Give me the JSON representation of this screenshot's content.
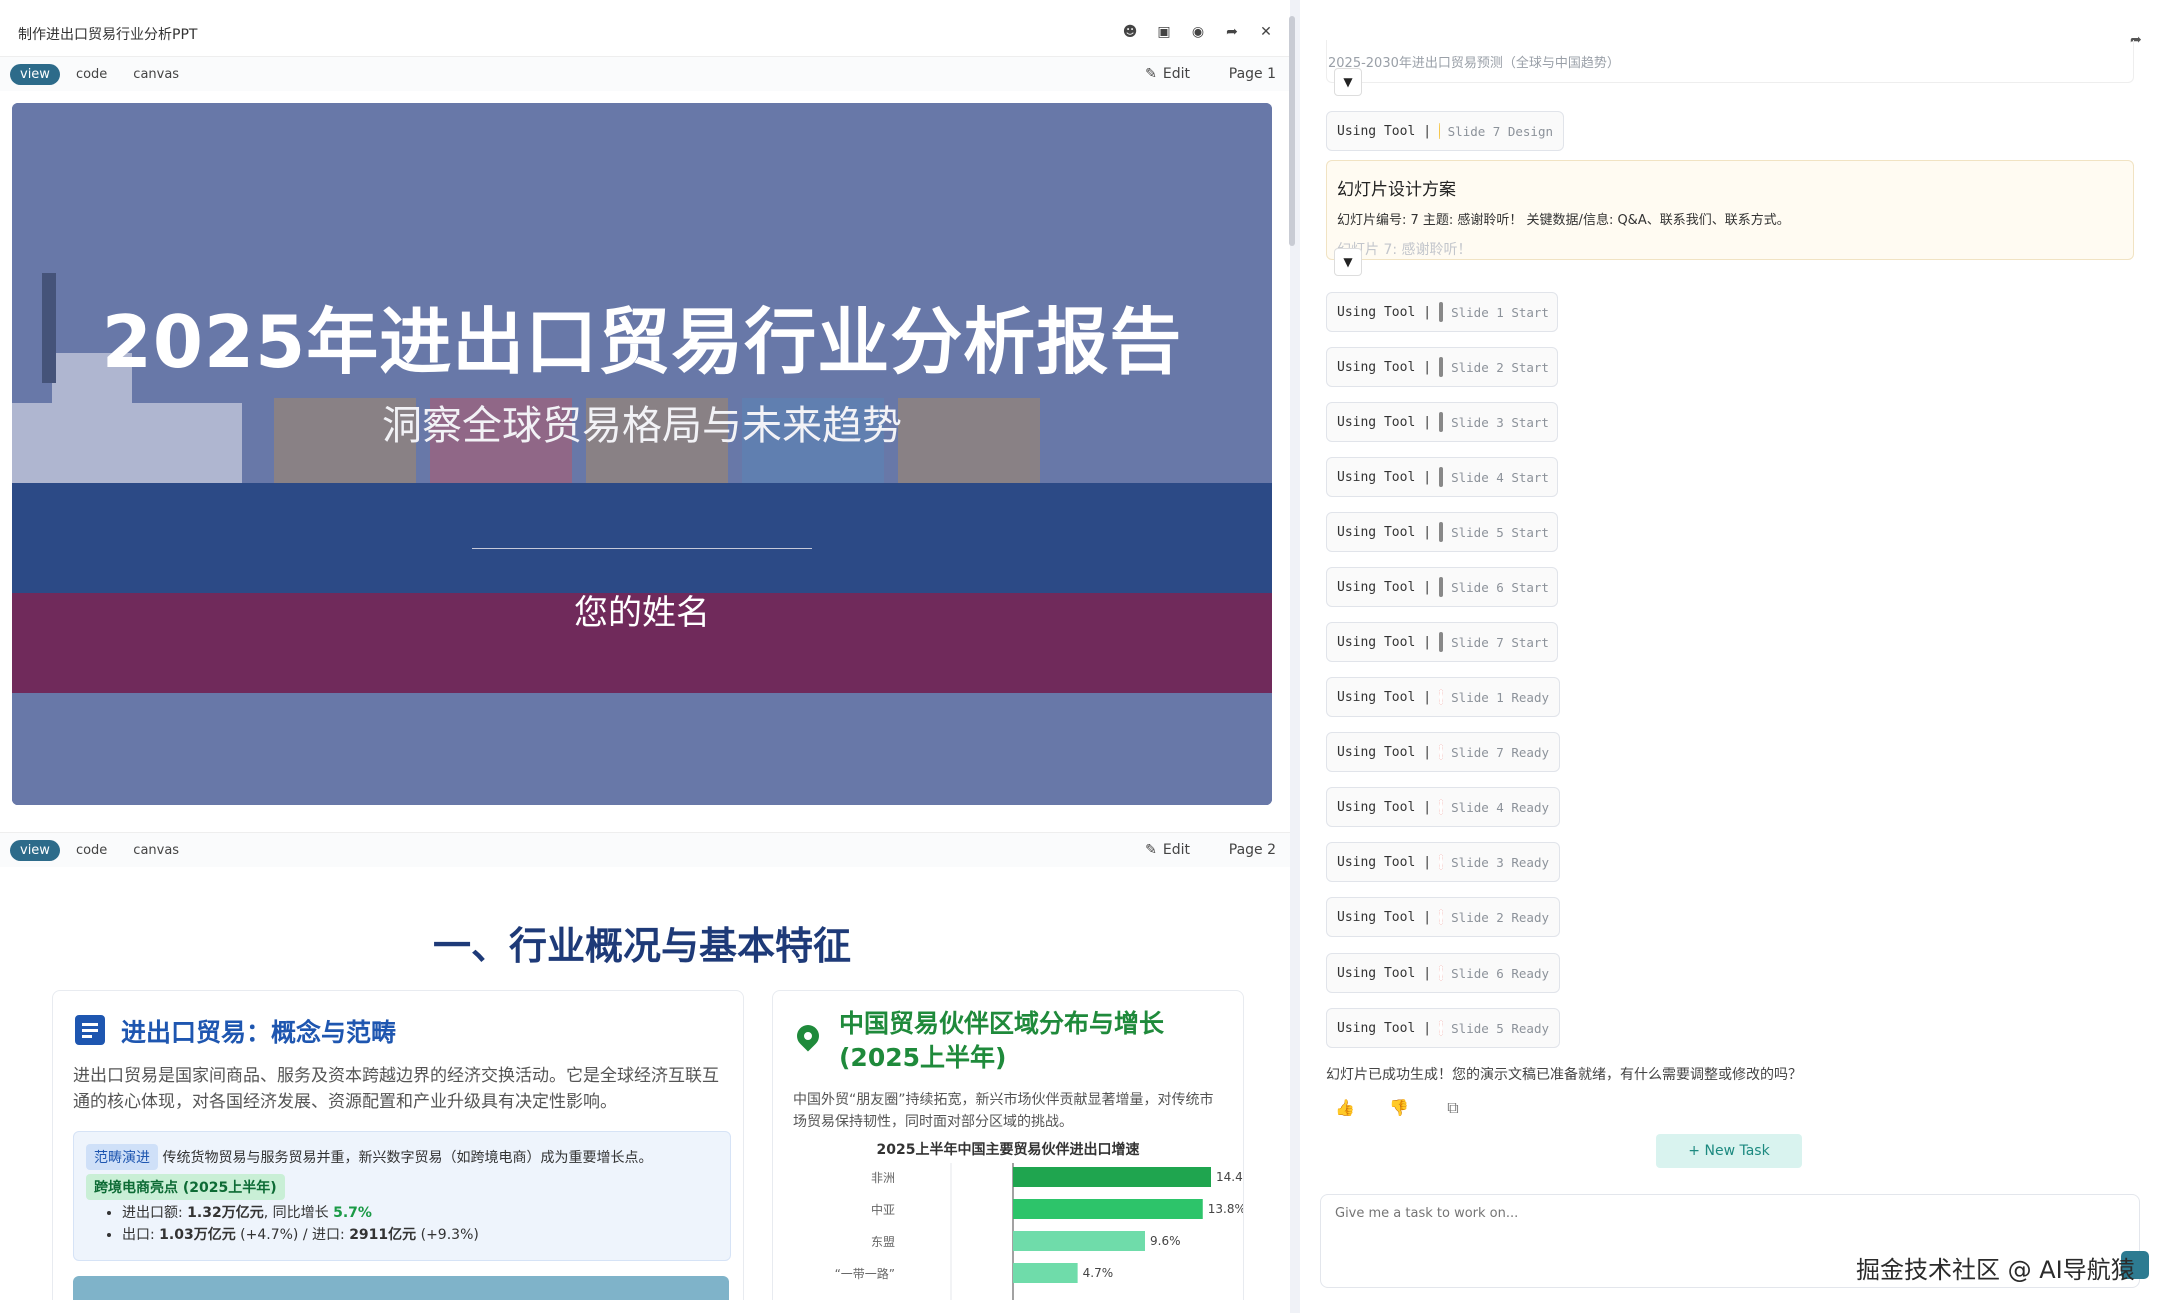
{
  "window": {
    "title": "制作进出口贸易行业分析PPT"
  },
  "tabs": {
    "view": "view",
    "code": "code",
    "canvas": "canvas",
    "edit": "Edit"
  },
  "page1": {
    "page_label": "Page 1"
  },
  "page2": {
    "page_label": "Page 2"
  },
  "slide1": {
    "title": "2025年进出口贸易行业分析报告",
    "subtitle": "洞察全球贸易格局与未来趋势",
    "name": "您的姓名"
  },
  "slide2": {
    "heading": "一、行业概况与基本特征",
    "card1": {
      "title": "进出口贸易：概念与范畴",
      "desc": "进出口贸易是国家间商品、服务及资本跨越边界的经济交换活动。它是全球经济互联互通的核心体现，对各国经济发展、资源配置和产业升级具有决定性影响。",
      "tag1": "范畴演进",
      "tag1_text": "传统货物贸易与服务贸易并重，新兴数字贸易（如跨境电商）成为重要增长点。",
      "tag2": "跨境电商亮点 (2025上半年)",
      "b1_pre": "进出口额: ",
      "b1_val": "1.32万亿元",
      "b1_mid": ", 同比增长 ",
      "b1_growth": "5.7%",
      "b2_pre": "出口: ",
      "b2_exp": "1.03万亿元",
      "b2_mid": " (+4.7%) / 进口: ",
      "b2_imp": "2911亿元",
      "b2_post": " (+9.3%)"
    },
    "card2": {
      "title": "中国贸易伙伴区域分布与增长 (2025上半年)",
      "desc": "中国外贸“朋友圈”持续拓宽，新兴市场伙伴贡献显著增量，对传统市场贸易保持韧性，同时面对部分区域的挑战。",
      "chart_title": "2025上半年中国主要贸易伙伴进出口增速"
    }
  },
  "chart_data": {
    "type": "bar",
    "orientation": "horizontal",
    "title": "2025上半年中国主要贸易伙伴进出口增速",
    "categories": [
      "非洲",
      "中亚",
      "东盟",
      "“一带一路”"
    ],
    "values": [
      14.4,
      13.8,
      9.6,
      4.7
    ],
    "value_labels": [
      "14.4%",
      "13.8%",
      "9.6%",
      "4.7%"
    ],
    "xlim": [
      0,
      16
    ],
    "colors": [
      "#1fa54f",
      "#2dc46a",
      "#6fdcaa",
      "#6fdcaa"
    ]
  },
  "right": {
    "faded_top": "2025-2030年进出口贸易预测（全球与中国趋势）",
    "using_tool": "Using Tool",
    "sep": "|",
    "tools": [
      {
        "icon": "bulb",
        "label": "Slide 7 Design"
      },
      {
        "icon": "clipboard",
        "label": "Slide 1 Start"
      },
      {
        "icon": "clipboard",
        "label": "Slide 2 Start"
      },
      {
        "icon": "clipboard",
        "label": "Slide 3 Start"
      },
      {
        "icon": "clipboard",
        "label": "Slide 4 Start"
      },
      {
        "icon": "clipboard",
        "label": "Slide 5 Start"
      },
      {
        "icon": "clipboard",
        "label": "Slide 6 Start"
      },
      {
        "icon": "clipboard",
        "label": "Slide 7 Start"
      },
      {
        "icon": "target",
        "label": "Slide 1 Ready"
      },
      {
        "icon": "target",
        "label": "Slide 7 Ready"
      },
      {
        "icon": "target",
        "label": "Slide 4 Ready"
      },
      {
        "icon": "target",
        "label": "Slide 3 Ready"
      },
      {
        "icon": "target",
        "label": "Slide 2 Ready"
      },
      {
        "icon": "target",
        "label": "Slide 6 Ready"
      },
      {
        "icon": "target",
        "label": "Slide 5 Ready"
      }
    ],
    "design": {
      "heading": "幻灯片设计方案",
      "body": "幻灯片编号: 7 主题: 感谢聆听！ 关键数据/信息: Q&A、联系我们、联系方式。",
      "faded": "幻灯片 7: 感谢聆听！"
    },
    "done_msg": "幻灯片已成功生成！您的演示文稿已准备就绪，有什么需要调整或修改的吗？",
    "new_task": "+ New Task",
    "input_placeholder": "Give me a task to work on...",
    "chevron": "▼"
  },
  "watermark": "掘金技术社区 @ AI导航猿"
}
